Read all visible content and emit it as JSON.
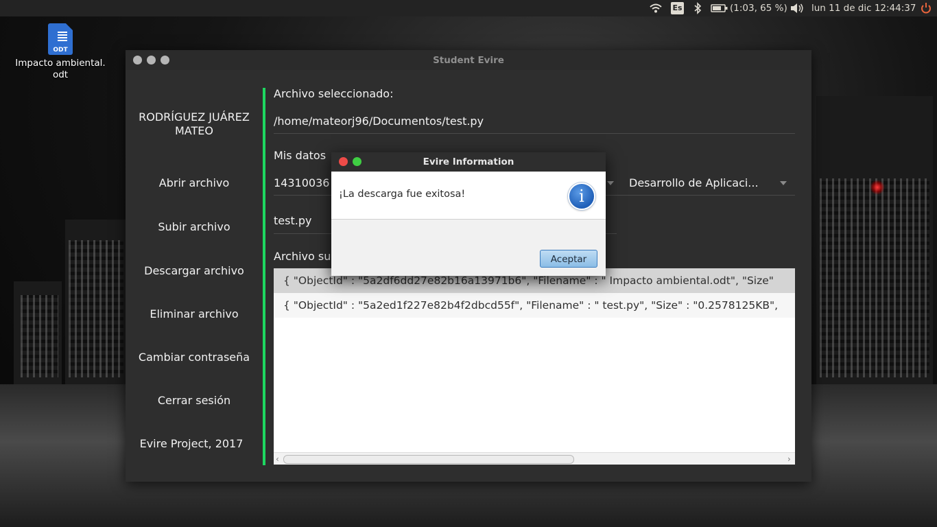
{
  "top_panel": {
    "keyboard_layout": "Es",
    "battery": "(1:03, 65 %)",
    "datetime": "lun 11 de dic 12:44:37",
    "icons": [
      "wifi-icon",
      "bluetooth-icon",
      "battery-icon",
      "volume-icon",
      "power-icon"
    ]
  },
  "desktop": {
    "file_name": "Impacto ambiental.\nodt",
    "file_badge": "ODT"
  },
  "window": {
    "title": "Student Evire",
    "sidebar": {
      "user_name": "RODRÍGUEZ JUÁREZ\nMATEO",
      "items": [
        "Abrir archivo",
        "Subir archivo",
        "Descargar archivo",
        "Eliminar archivo",
        "Cambiar contraseña",
        "Cerrar sesión"
      ],
      "footer": "Evire Project, 2017"
    },
    "main": {
      "selected_label": "Archivo seleccionado:",
      "selected_path": "/home/mateorj96/Documentos/test.py",
      "mydata_label": "Mis datos",
      "student_id": "14310036",
      "course": "Desarrollo de Aplicaci...",
      "filename_value": "test.py",
      "uploaded_label": "Archivo su",
      "list_rows": [
        "{ \"ObjectId\" : \"5a2df6dd27e82b16a13971b6\", \"Filename\" : \" Impacto ambiental.odt\", \"Size\"",
        "{ \"ObjectId\" : \"5a2ed1f227e82b4f2dbcd55f\", \"Filename\" : \" test.py\", \"Size\" : \"0.2578125KB\","
      ]
    }
  },
  "dialog": {
    "title": "Evire Information",
    "message": "¡La descarga fue exitosa!",
    "icon_glyph": "i",
    "ok_label": "Aceptar"
  },
  "colors": {
    "accent": "#1ed760",
    "window_bg": "#2e2e2e",
    "button_blue": "#8bbde6"
  }
}
